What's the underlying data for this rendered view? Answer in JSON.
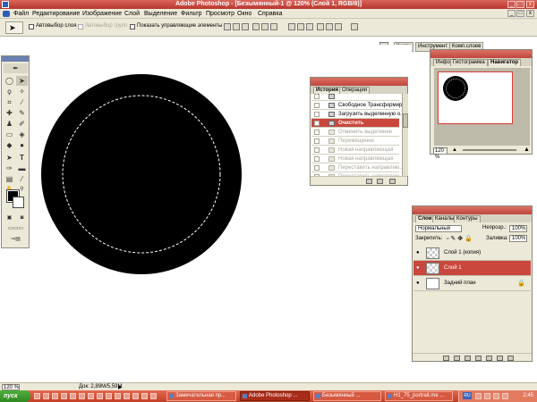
{
  "window": {
    "title": "Adobe Photoshop - [Безымянный-1 @ 120% (Слой 1, RGB/8)]"
  },
  "menu": [
    "Файл",
    "Редактирование",
    "Изображение",
    "Слой",
    "Выделение",
    "Фильтр",
    "Просмотр",
    "Окно",
    "Справка"
  ],
  "options": {
    "auto_select_layer": "Автовыбор слоя",
    "auto_select_group": "Автовыбор групп",
    "show_transform_controls": "Показать управляющие элементы"
  },
  "palette_well": {
    "tabs": [
      "Кисти",
      "Инструмент",
      "Комп.слоев"
    ]
  },
  "history": {
    "tabs": [
      "История",
      "Операции"
    ],
    "items": [
      {
        "label": "",
        "state": "normal"
      },
      {
        "label": "Свободное Трансформир...",
        "state": "normal"
      },
      {
        "label": "Загрузить выделенную о...",
        "state": "normal"
      },
      {
        "label": "Очистить",
        "state": "active"
      },
      {
        "label": "Отменить выделение",
        "state": "dim"
      },
      {
        "label": "Перемещение",
        "state": "dim"
      },
      {
        "label": "Новая направляющая",
        "state": "dim"
      },
      {
        "label": "Новая направляющая",
        "state": "dim"
      },
      {
        "label": "Переставить направляю...",
        "state": "dim"
      },
      {
        "label": "Переставить направляю...",
        "state": "dim"
      }
    ]
  },
  "navigator": {
    "tabs": [
      "Инфо",
      "Гистограмма",
      "Навигатор"
    ],
    "zoom": "120 %"
  },
  "layers": {
    "tabs": [
      "Слои",
      "Каналы",
      "Контуры"
    ],
    "blend_mode": "Нормальный",
    "opacity_label": "Непрозр.:",
    "opacity": "100%",
    "lock_label": "Закрепить:",
    "fill_label": "Заливка:",
    "fill": "100%",
    "items": [
      {
        "name": "Слой 1 (копия)",
        "active": false,
        "visible": true
      },
      {
        "name": "Слой 1",
        "active": true,
        "visible": true
      },
      {
        "name": "Задний план",
        "active": false,
        "visible": true
      }
    ]
  },
  "status": {
    "zoom": "120 %",
    "doc": "Док: 2,89M/5,59M"
  },
  "taskbar": {
    "start": "пуск",
    "tasks": [
      {
        "label": "Замечательная пр...",
        "active": false
      },
      {
        "label": "Adobe Photoshop ...",
        "active": true
      },
      {
        "label": "Безымянный ...",
        "active": false
      },
      {
        "label": "H1_75_portrait.me ...",
        "active": false
      }
    ],
    "lang": "RU",
    "clock": "2:45"
  },
  "colors": {
    "foreground": "#000000",
    "background": "#ffffff",
    "accent": "#c9473c"
  }
}
